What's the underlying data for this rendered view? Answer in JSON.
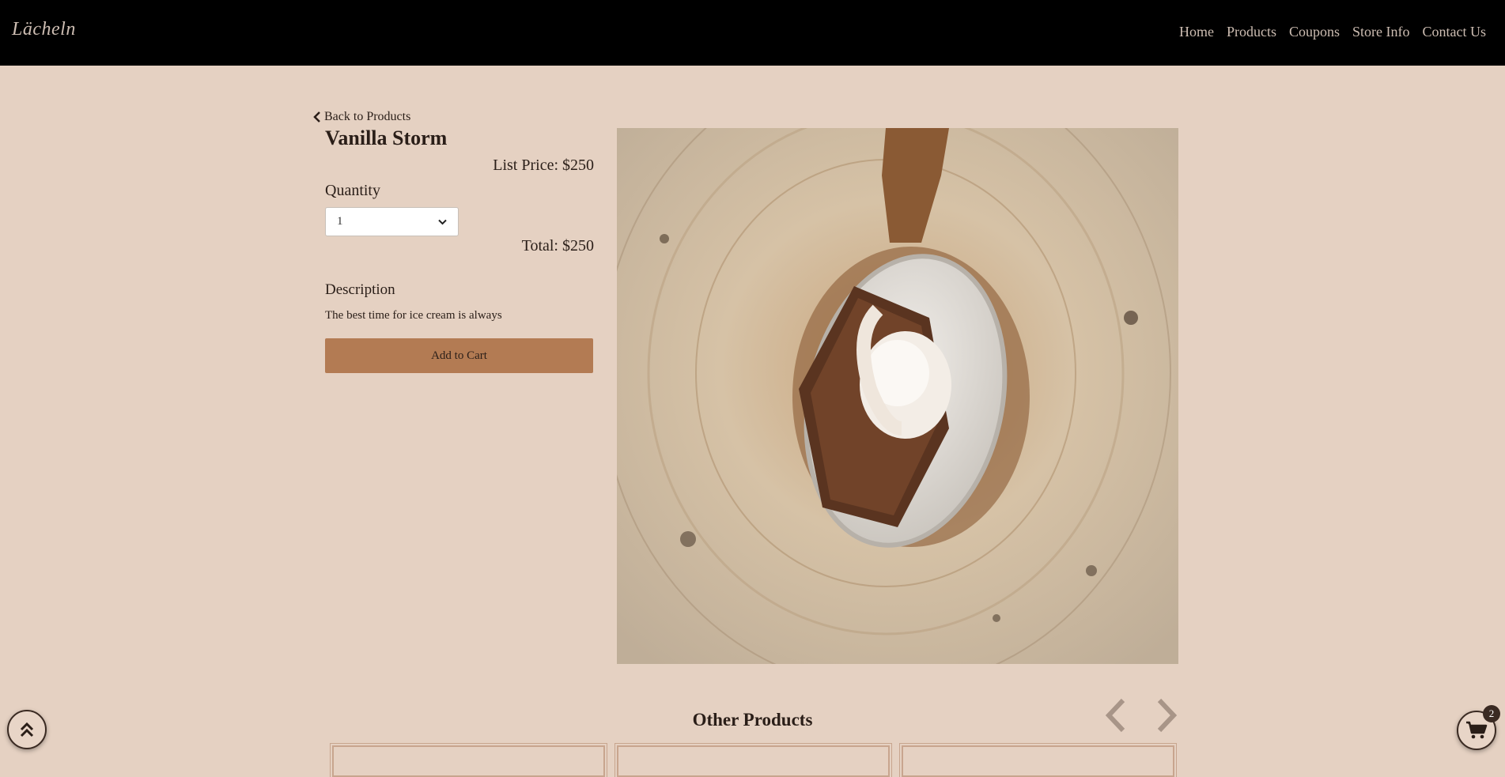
{
  "header": {
    "brand": "Lächeln",
    "nav": [
      {
        "label": "Home"
      },
      {
        "label": "Products"
      },
      {
        "label": "Coupons"
      },
      {
        "label": "Store Info"
      },
      {
        "label": "Contact Us"
      }
    ]
  },
  "product": {
    "back_label": "Back to Products",
    "title": "Vanilla Storm",
    "list_price": "List Price: $250",
    "quantity_label": "Quantity",
    "quantity_value": "1",
    "total": "Total: $250",
    "description_title": "Description",
    "description": "The best time for ice cream is always",
    "add_to_cart": "Add to Cart"
  },
  "other_products": {
    "title": "Other Products"
  },
  "cart": {
    "count": "2"
  },
  "colors": {
    "background": "#e5d1c2",
    "navbar": "#000000",
    "accent_button": "#b37b53",
    "text": "#2a1e18"
  },
  "icons": [
    "chevron-left-icon",
    "chevron-down-icon",
    "double-chevron-up-icon",
    "shopping-cart-icon"
  ]
}
